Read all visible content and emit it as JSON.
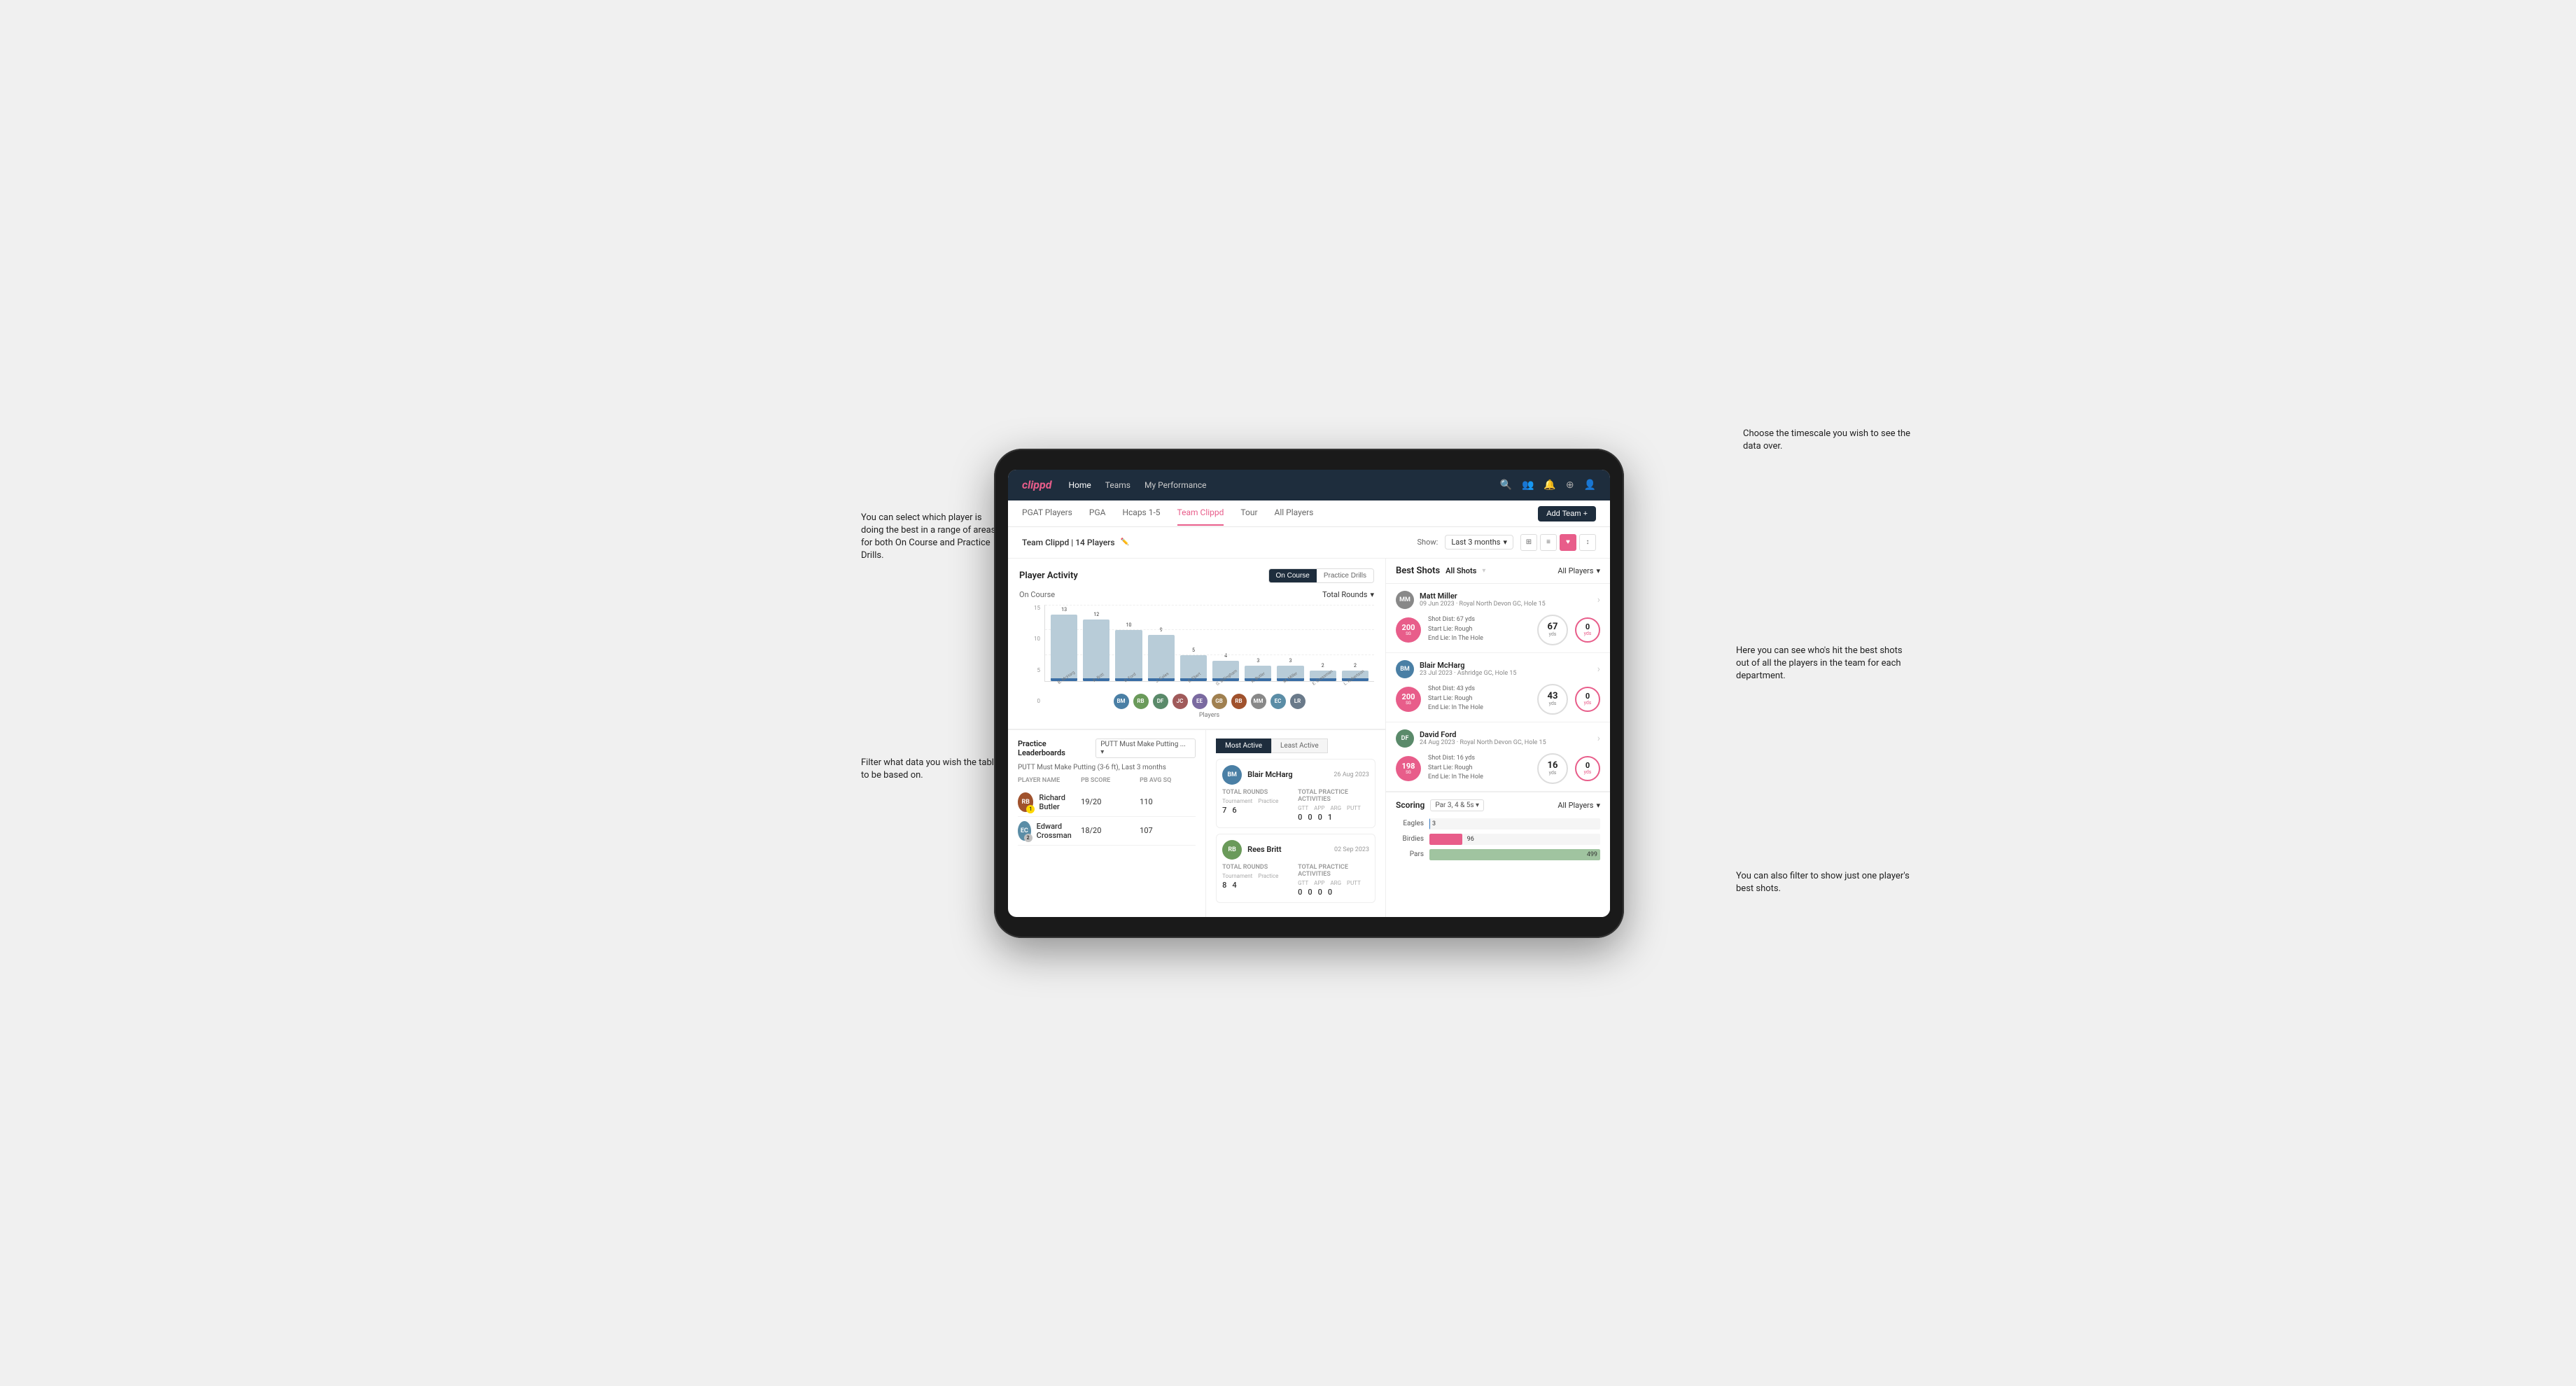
{
  "annotations": {
    "ann1": "You can select which player is doing the best in a range of areas for both On Course and Practice Drills.",
    "ann2": "Choose the timescale you wish to see the data over.",
    "ann3": "Filter what data you wish the table to be based on.",
    "ann4": "Here you can see who's hit the best shots out of all the players in the team for each department.",
    "ann5": "You can also filter to show just one player's best shots."
  },
  "nav": {
    "logo": "clippd",
    "links": [
      "Home",
      "Teams",
      "My Performance"
    ],
    "subLinks": [
      "PGAT Players",
      "PGA",
      "Hcaps 1-5",
      "Team Clippd",
      "Tour",
      "All Players"
    ],
    "activeSubLink": "Team Clippd",
    "addBtn": "Add Team +"
  },
  "teamHeader": {
    "title": "Team Clippd | 14 Players",
    "showLabel": "Show:",
    "timeFilter": "Last 3 months",
    "viewIcons": [
      "⊞",
      "⊟",
      "♥",
      "↕"
    ]
  },
  "playerActivity": {
    "sectionTitle": "Player Activity",
    "toggleOptions": [
      "On Course",
      "Practice Drills"
    ],
    "activeToggle": "On Course",
    "chartLabel": "On Course",
    "chartFilter": "Total Rounds",
    "xAxisLabel": "Players",
    "yAxisLabel": "Total Rounds",
    "yAxisValues": [
      "15",
      "10",
      "5",
      "0"
    ],
    "bars": [
      {
        "name": "B. McHarg",
        "value": 13,
        "maxVal": 15,
        "initials": "BM",
        "color": "#7fb3c8"
      },
      {
        "name": "R. Britt",
        "value": 12,
        "maxVal": 15,
        "initials": "RB",
        "color": "#7fb3c8"
      },
      {
        "name": "D. Ford",
        "value": 10,
        "maxVal": 15,
        "initials": "DF",
        "color": "#7fb3c8"
      },
      {
        "name": "J. Coles",
        "value": 9,
        "maxVal": 15,
        "initials": "JC",
        "color": "#7fb3c8"
      },
      {
        "name": "E. Ebert",
        "value": 5,
        "maxVal": 15,
        "initials": "EE",
        "color": "#7fb3c8"
      },
      {
        "name": "G. Billingham",
        "value": 4,
        "maxVal": 15,
        "initials": "GB",
        "color": "#7fb3c8"
      },
      {
        "name": "R. Butler",
        "value": 3,
        "maxVal": 15,
        "initials": "RBu",
        "color": "#7fb3c8"
      },
      {
        "name": "M. Miller",
        "value": 3,
        "maxVal": 15,
        "initials": "MM",
        "color": "#7fb3c8"
      },
      {
        "name": "E. Crossman",
        "value": 2,
        "maxVal": 15,
        "initials": "EC",
        "color": "#7fb3c8"
      },
      {
        "name": "L. Robertson",
        "value": 2,
        "maxVal": 15,
        "initials": "LR",
        "color": "#7fb3c8"
      }
    ]
  },
  "practiceLeaderboards": {
    "sectionTitle": "Practice Leaderboards",
    "filterLabel": "PUTT Must Make Putting ...",
    "subtitle": "PUTT Must Make Putting (3-6 ft), Last 3 months",
    "columns": [
      "PLAYER NAME",
      "PB SCORE",
      "PB AVG SQ"
    ],
    "rows": [
      {
        "name": "Richard Butler",
        "initials": "RB",
        "pbScore": "19/20",
        "pbAvgSq": "110",
        "rank": "1",
        "rankColor": "gold",
        "avatarColor": "#a0522d"
      },
      {
        "name": "Edward Crossman",
        "initials": "EC",
        "pbScore": "18/20",
        "pbAvgSq": "107",
        "rank": "2",
        "rankColor": "silver",
        "avatarColor": "#5b8da6"
      }
    ]
  },
  "mostActive": {
    "tabs": [
      "Most Active",
      "Least Active"
    ],
    "activeTab": "Most Active",
    "players": [
      {
        "name": "Blair McHarg",
        "date": "26 Aug 2023",
        "initials": "BM",
        "avatarColor": "#4a7fa5",
        "totalRoundsLabel": "Total Rounds",
        "tournament": 7,
        "practice": 6,
        "totalPracticeLabel": "Total Practice Activities",
        "gtt": 0,
        "app": 0,
        "arg": 0,
        "putt": 1
      },
      {
        "name": "Rees Britt",
        "date": "02 Sep 2023",
        "initials": "RB",
        "avatarColor": "#6a9a5a",
        "totalRoundsLabel": "Total Rounds",
        "tournament": 8,
        "practice": 4,
        "totalPracticeLabel": "Total Practice Activities",
        "gtt": 0,
        "app": 0,
        "arg": 0,
        "putt": 0
      }
    ]
  },
  "bestShots": {
    "sectionTitle": "Best Shots",
    "tabs": [
      "All Shots",
      "All Players"
    ],
    "allPlayersLabel": "All Players",
    "shots": [
      {
        "playerName": "Matt Miller",
        "details": "09 Jun 2023 · Royal North Devon GC, Hole 15",
        "initials": "MM",
        "avatarColor": "#888",
        "badgeNum": "200",
        "badgeLabel": "SG",
        "shotDist": "Shot Dist: 67 yds",
        "startLie": "Start Lie: Rough",
        "endLie": "End Lie: In The Hole",
        "distYards": "67",
        "zeroVal": "0"
      },
      {
        "playerName": "Blair McHarg",
        "details": "23 Jul 2023 · Ashridge GC, Hole 15",
        "initials": "BM",
        "avatarColor": "#4a7fa5",
        "badgeNum": "200",
        "badgeLabel": "SG",
        "shotDist": "Shot Dist: 43 yds",
        "startLie": "Start Lie: Rough",
        "endLie": "End Lie: In The Hole",
        "distYards": "43",
        "zeroVal": "0"
      },
      {
        "playerName": "David Ford",
        "details": "24 Aug 2023 · Royal North Devon GC, Hole 15",
        "initials": "DF",
        "avatarColor": "#5a8a6a",
        "badgeNum": "198",
        "badgeLabel": "SG",
        "shotDist": "Shot Dist: 16 yds",
        "startLie": "Start Lie: Rough",
        "endLie": "End Lie: In The Hole",
        "distYards": "16",
        "zeroVal": "0"
      }
    ]
  },
  "scoring": {
    "sectionTitle": "Scoring",
    "filterLabel": "Par 3, 4 & 5s",
    "allPlayersLabel": "All Players",
    "rows": [
      {
        "label": "Eagles",
        "value": 3,
        "max": 500,
        "color": "#3a7abf"
      },
      {
        "label": "Birdies",
        "value": 96,
        "max": 500,
        "color": "#e85d8a"
      },
      {
        "label": "Pars",
        "value": 499,
        "max": 500,
        "color": "#a0c4a0"
      }
    ]
  }
}
